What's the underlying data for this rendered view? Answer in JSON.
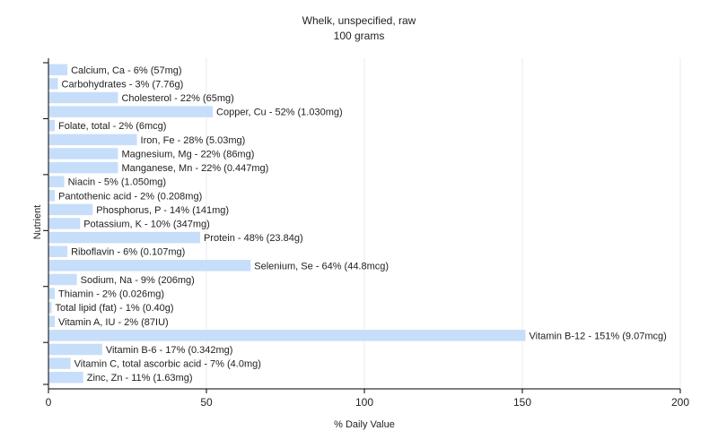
{
  "chart_data": {
    "type": "bar",
    "orientation": "horizontal",
    "title": "Whelk, unspecified, raw",
    "subtitle": "100 grams",
    "xlabel": "% Daily Value",
    "ylabel": "Nutrient",
    "xlim": [
      0,
      200
    ],
    "xticks": [
      0,
      50,
      100,
      150,
      200
    ],
    "grid": true,
    "bar_color": "#c6defa",
    "categories": [
      "Calcium, Ca - 6% (57mg)",
      "Carbohydrates - 3% (7.76g)",
      "Cholesterol - 22% (65mg)",
      "Copper, Cu - 52% (1.030mg)",
      "Folate, total - 2% (6mcg)",
      "Iron, Fe - 28% (5.03mg)",
      "Magnesium, Mg - 22% (86mg)",
      "Manganese, Mn - 22% (0.447mg)",
      "Niacin - 5% (1.050mg)",
      "Pantothenic acid - 2% (0.208mg)",
      "Phosphorus, P - 14% (141mg)",
      "Potassium, K - 10% (347mg)",
      "Protein - 48% (23.84g)",
      "Riboflavin - 6% (0.107mg)",
      "Selenium, Se - 64% (44.8mcg)",
      "Sodium, Na - 9% (206mg)",
      "Thiamin - 2% (0.026mg)",
      "Total lipid (fat) - 1% (0.40g)",
      "Vitamin A, IU - 2% (87IU)",
      "Vitamin B-12 - 151% (9.07mcg)",
      "Vitamin B-6 - 17% (0.342mg)",
      "Vitamin C, total ascorbic acid - 7% (4.0mg)",
      "Zinc, Zn - 11% (1.63mg)"
    ],
    "values": [
      6,
      3,
      22,
      52,
      2,
      28,
      22,
      22,
      5,
      2,
      14,
      10,
      48,
      6,
      64,
      9,
      2,
      1,
      2,
      151,
      17,
      7,
      11
    ]
  }
}
